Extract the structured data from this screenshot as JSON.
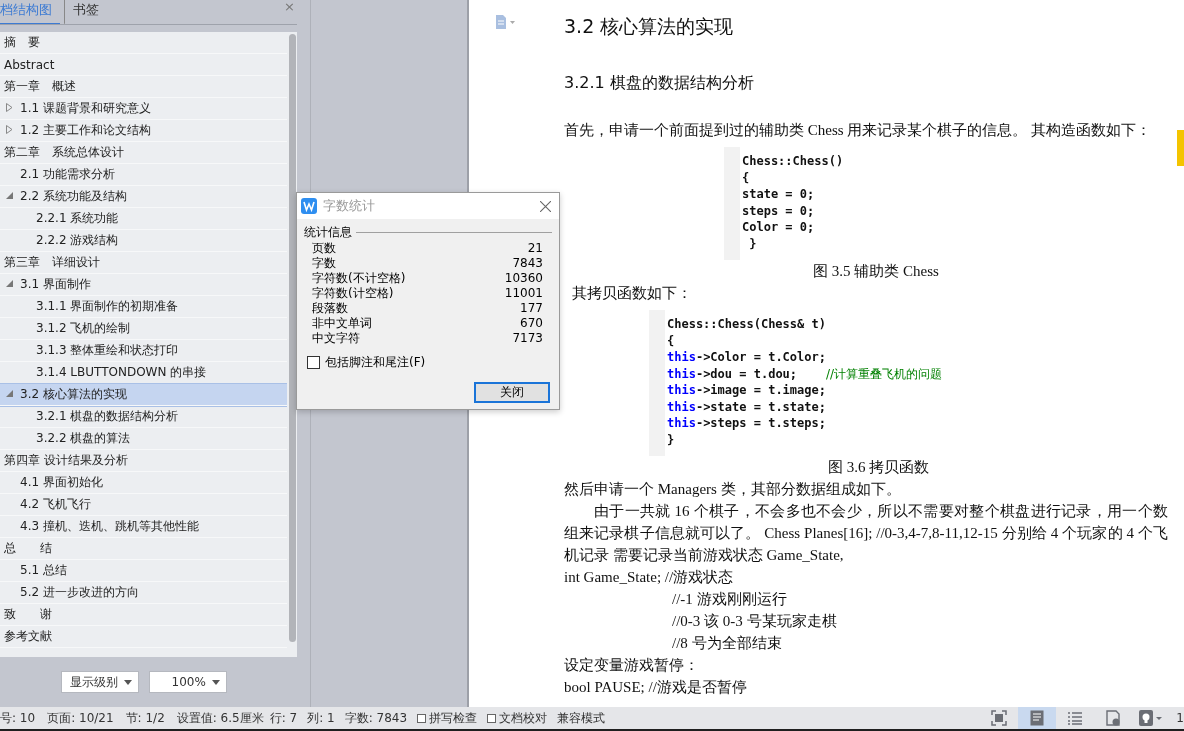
{
  "nav_panel": {
    "tabs": [
      {
        "label": "档结构图",
        "selected": true
      },
      {
        "label": "书签",
        "selected": false
      }
    ],
    "close": "×",
    "tree": [
      {
        "label": "摘　要"
      },
      {
        "label": "Abstract"
      },
      {
        "label": "第一章　概述",
        "children": [
          {
            "label": "1.1  课题背景和研究意义",
            "expanded": false
          },
          {
            "label": "1.2  主要工作和论文结构",
            "expanded": false
          }
        ]
      },
      {
        "label": "第二章　系统总体设计",
        "children": [
          {
            "label": "2.1  功能需求分析"
          },
          {
            "label": "2.2  系统功能及结构",
            "expanded": true,
            "children": [
              {
                "label": "2.2.1 系统功能"
              },
              {
                "label": "2.2.2 游戏结构"
              }
            ]
          }
        ]
      },
      {
        "label": "第三章　详细设计",
        "children": [
          {
            "label": "3.1  界面制作",
            "expanded": true,
            "children": [
              {
                "label": "3.1.1  界面制作的初期准备"
              },
              {
                "label": "3.1.2  飞机的绘制"
              },
              {
                "label": "3.1.3  整体重绘和状态打印"
              },
              {
                "label": "3.1.4 LBUTTONDOWN 的串接"
              }
            ]
          },
          {
            "label": "3.2  核心算法的实现",
            "expanded": true,
            "selected": true,
            "children": [
              {
                "label": "3.2.1  棋盘的数据结构分析"
              },
              {
                "label": "3.2.2  棋盘的算法"
              }
            ]
          }
        ]
      },
      {
        "label": "第四章  设计结果及分析",
        "children": [
          {
            "label": "4.1  界面初始化"
          },
          {
            "label": "4.2  飞机飞行"
          },
          {
            "label": "4.3  撞机、迭机、跳机等其他性能"
          }
        ]
      },
      {
        "label": "总　　结",
        "children": [
          {
            "label": "5.1  总结"
          },
          {
            "label": "5.2 进一步改进的方向"
          }
        ]
      },
      {
        "label": "致　　谢"
      },
      {
        "label": "参考文献"
      }
    ],
    "level_select": "显示级别",
    "zoom_select": "100%"
  },
  "dialog": {
    "title": "字数统计",
    "group": "统计信息",
    "stats": [
      {
        "label": "页数",
        "value": "21"
      },
      {
        "label": "字数",
        "value": "7843"
      },
      {
        "label": "字符数(不计空格)",
        "value": "10360"
      },
      {
        "label": "字符数(计空格)",
        "value": "11001"
      },
      {
        "label": "段落数",
        "value": "177"
      },
      {
        "label": "非中文单词",
        "value": "670"
      },
      {
        "label": "中文字符",
        "value": "7173"
      }
    ],
    "checkbox": {
      "label": "包括脚注和尾注(F)",
      "checked": false
    },
    "button": "关闭"
  },
  "document": [
    {
      "kind": "h1",
      "text": "3.2  核心算法的实现"
    },
    {
      "kind": "h2",
      "text": "3.2.1  棋盘的数据结构分析"
    },
    {
      "kind": "para",
      "text": "首先，申请一个前面提到过的辅助类 Chess 用来记录某个棋子的信息。 其构造函数如下："
    },
    {
      "kind": "code",
      "lines": [
        [
          {
            "t": "Chess::Chess()",
            "kind": "plain"
          }
        ],
        [
          {
            "t": "{",
            "kind": "plain"
          }
        ],
        [
          {
            "t": "state = 0;",
            "kind": "plain"
          }
        ],
        [
          {
            "t": "steps = 0;",
            "kind": "plain"
          }
        ],
        [
          {
            "t": "Color = 0;",
            "kind": "plain"
          }
        ],
        [
          {
            "t": " }",
            "kind": "plain"
          }
        ]
      ]
    },
    {
      "kind": "caption",
      "text": "图 3.5  辅助类 Chess"
    },
    {
      "kind": "outdent",
      "text": "其拷贝函数如下："
    },
    {
      "kind": "code",
      "lines": [
        [
          {
            "t": "Chess::Chess(Chess& t)",
            "kind": "plain"
          }
        ],
        [
          {
            "t": "{",
            "kind": "plain"
          }
        ],
        [
          {
            "t": "this",
            "kind": "keyword"
          },
          {
            "t": "->Color = t.Color;",
            "kind": "plain"
          }
        ],
        [
          {
            "t": "this",
            "kind": "keyword"
          },
          {
            "t": "->dou = t.dou;    ",
            "kind": "plain"
          },
          {
            "t": "//计算重叠飞机的问题",
            "kind": "comment"
          }
        ],
        [
          {
            "t": "this",
            "kind": "keyword"
          },
          {
            "t": "->image = t.image;",
            "kind": "plain"
          }
        ],
        [
          {
            "t": "this",
            "kind": "keyword"
          },
          {
            "t": "->state = t.state;",
            "kind": "plain"
          }
        ],
        [
          {
            "t": "this",
            "kind": "keyword"
          },
          {
            "t": "->steps = t.steps;",
            "kind": "plain"
          }
        ],
        [
          {
            "t": "}",
            "kind": "plain"
          }
        ]
      ]
    },
    {
      "kind": "caption",
      "text": "图 3.6  拷贝函数"
    },
    {
      "kind": "line",
      "text": "然后申请一个 Managers 类，其部分数据组成如下。"
    },
    {
      "kind": "para",
      "text": "由于一共就 16 个棋子，不会多也不会少，所以不需要对整个棋盘进行记录，用一个数组来记录棋子信息就可以了。  Chess Planes[16];     //0-3,4-7,8-11,12-15 分别给 4 个玩家的 4 个飞机记录  需要记录当前游戏状态 Game_State,"
    },
    {
      "kind": "line",
      "text": "int Game_State;     //游戏状态"
    },
    {
      "kind": "note",
      "text": "//-1    游戏刚刚运行"
    },
    {
      "kind": "note",
      "text": "//0-3  该 0-3 号某玩家走棋"
    },
    {
      "kind": "note",
      "text": "//8 号为全部结束"
    },
    {
      "kind": "line",
      "text": "设定变量游戏暂停："
    },
    {
      "kind": "line",
      "text": "bool PAUSE;      //游戏是否暂停"
    }
  ],
  "status_bar": {
    "items": [
      {
        "text": "号: 10"
      },
      {
        "text": "页面: 10/21"
      },
      {
        "text": "节: 1/2"
      },
      {
        "text": "设置值: 6.5厘米"
      },
      {
        "text": "行: 7"
      },
      {
        "text": "列: 1"
      },
      {
        "text": "字数: 7843"
      },
      {
        "text": "拼写检查",
        "checked": false
      },
      {
        "text": "文档校对",
        "checked": false
      },
      {
        "text": "兼容模式"
      }
    ],
    "views": [
      {
        "kind": "fullscreen",
        "selected": false
      },
      {
        "kind": "page",
        "selected": true
      },
      {
        "kind": "outline",
        "selected": false
      },
      {
        "kind": "web",
        "selected": false
      },
      {
        "kind": "bulb",
        "selected": false
      }
    ],
    "edge_text": "1"
  }
}
